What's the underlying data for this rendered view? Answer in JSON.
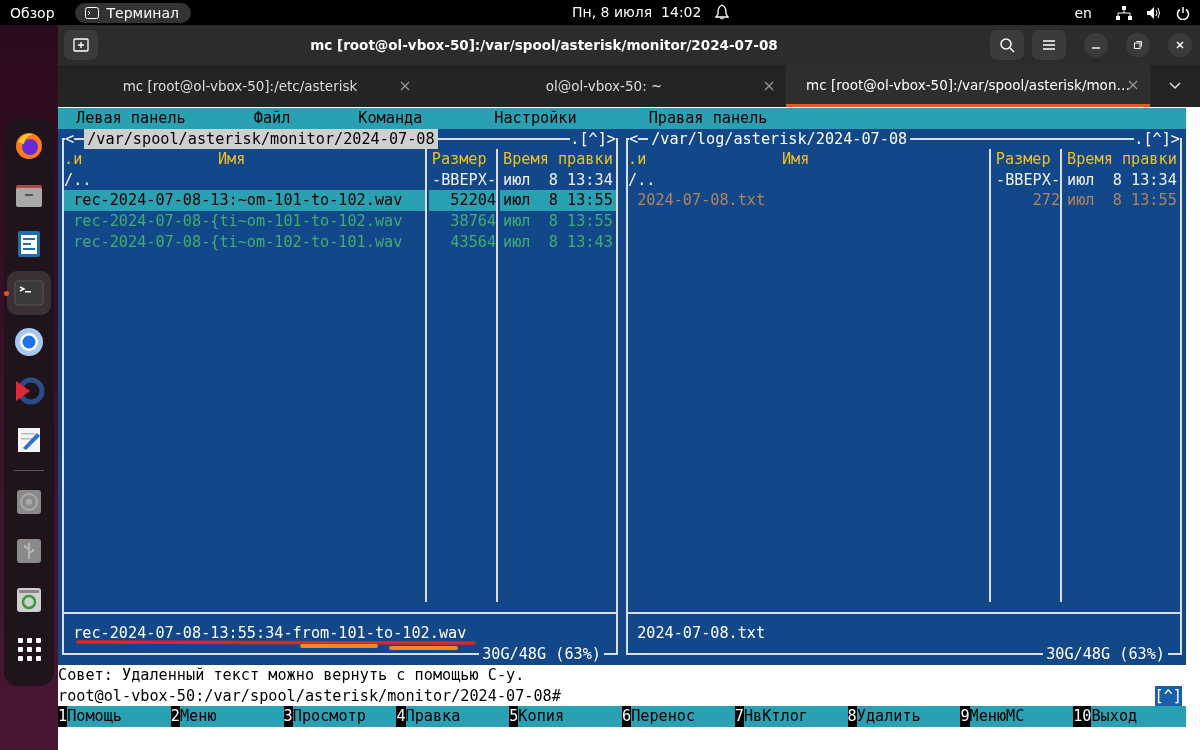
{
  "topbar": {
    "activities": "Обзор",
    "app": "Терминал",
    "clock": "Пн, 8 июля  14:02",
    "lang": "en"
  },
  "dock": {
    "favorites": [
      {
        "kind": "browser",
        "selected": false
      },
      {
        "kind": "folder",
        "selected": false
      },
      {
        "kind": "document",
        "selected": false
      },
      {
        "kind": "terminal",
        "selected": true
      },
      {
        "kind": "globe",
        "selected": false
      },
      {
        "kind": "player",
        "selected": false
      },
      {
        "kind": "editor",
        "selected": false
      }
    ],
    "devices": [
      {
        "kind": "disc",
        "selected": false
      },
      {
        "kind": "usb",
        "selected": false
      },
      {
        "kind": "trash",
        "selected": false
      },
      {
        "kind": "apps",
        "selected": false
      }
    ]
  },
  "window": {
    "title": "mc [root@ol-vbox-50]:/var/spool/asterisk/monitor/2024-07-08"
  },
  "tabs": [
    {
      "label": "mc [root@ol-vbox-50]:/etc/asterisk",
      "selected": false
    },
    {
      "label": "ol@ol-vbox-50: ~",
      "selected": false
    },
    {
      "label": "mc [root@ol-vbox-50]:/var/spool/asterisk/mon…",
      "selected": true
    }
  ],
  "menu": [
    "Левая панель",
    "Файл",
    "Команда",
    "Настройки",
    "Правая панель"
  ],
  "panels": [
    {
      "left_mark": "<",
      "title": "/var/spool/asterisk/monitor/2024-07-08",
      "active": true,
      "right_mark": ".[^]>",
      "columns": {
        "flag": ".и",
        "name": "Имя",
        "size": "Размер",
        "time": "Время правки"
      },
      "rows": [
        {
          "kind": "updir",
          "name": "/..",
          "size": "-ВВЕРХ-",
          "time": "июл  8 13:34",
          "selected": false
        },
        {
          "kind": "audio",
          "name": "rec-2024-07-08-13:~om-101-to-102.wav",
          "size": "52204",
          "time": "июл  8 13:55",
          "selected": true
        },
        {
          "kind": "audio",
          "name": "rec-2024-07-08-{ti~om-101-to-102.wav",
          "size": "38764",
          "time": "июл  8 13:55",
          "selected": false
        },
        {
          "kind": "audio",
          "name": "rec-2024-07-08-{ti~om-102-to-101.wav",
          "size": "43564",
          "time": "июл  8 13:43",
          "selected": false
        }
      ],
      "status": "rec-2024-07-08-13:55:34-from-101-to-102.wav",
      "disk": "30G/48G (63%)"
    },
    {
      "left_mark": "<",
      "title": "/var/log/asterisk/2024-07-08",
      "active": false,
      "right_mark": ".[^]>",
      "columns": {
        "flag": ".и",
        "name": "Имя",
        "size": "Размер",
        "time": "Время правки"
      },
      "rows": [
        {
          "kind": "updir",
          "name": "/..",
          "size": "-ВВЕРХ-",
          "time": "июл  8 13:34",
          "selected": false
        },
        {
          "kind": "text",
          "name": "2024-07-08.txt",
          "size": "272",
          "time": "июл  8 13:55",
          "selected": false
        }
      ],
      "status": "2024-07-08.txt",
      "disk": "30G/48G (63%)"
    }
  ],
  "hint": "Совет: Удаленный текст можно вернуть с помощью C-y.",
  "prompt": "root@ol-vbox-50:/var/spool/asterisk/monitor/2024-07-08#",
  "prompt_mark": "[^]",
  "fkeys": [
    {
      "num": "1",
      "label": "Помощь"
    },
    {
      "num": "2",
      "label": "Меню"
    },
    {
      "num": "3",
      "label": "Просмотр"
    },
    {
      "num": "4",
      "label": "Правка"
    },
    {
      "num": "5",
      "label": "Копия"
    },
    {
      "num": "6",
      "label": "Перенос"
    },
    {
      "num": "7",
      "label": "НвКтлог"
    },
    {
      "num": "8",
      "label": "Удалить"
    },
    {
      "num": "9",
      "label": "МенюMC"
    },
    {
      "num": "10",
      "label": "Выход"
    }
  ]
}
